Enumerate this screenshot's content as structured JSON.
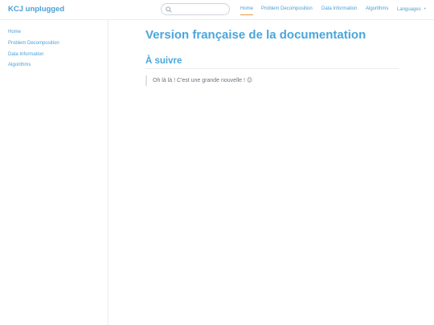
{
  "header": {
    "site_name": "KCJ unplugged",
    "search": {
      "placeholder": "",
      "value": ""
    },
    "nav": [
      {
        "label": "Home",
        "active": true
      },
      {
        "label": "Problem Decomposition",
        "active": false
      },
      {
        "label": "Data Information",
        "active": false
      },
      {
        "label": "Algorithms",
        "active": false
      },
      {
        "label": "Languages",
        "active": false,
        "has_dropdown": true
      }
    ]
  },
  "sidebar": {
    "items": [
      {
        "label": "Home"
      },
      {
        "label": "Problem Decomposition"
      },
      {
        "label": "Data Information"
      },
      {
        "label": "Algorithms"
      }
    ]
  },
  "main": {
    "title": "Version française de la documentation",
    "section_title": "À suivre",
    "blockquote": "Oh là là ! C'est une grande nouvelle ! 😉"
  },
  "colors": {
    "accent": "#4aa6dc",
    "active_underline": "#e69a3c",
    "border": "#eaecef",
    "quote_text": "#6a737d"
  },
  "icons": {
    "search": "search-icon",
    "dropdown": "chevron-down-icon"
  }
}
